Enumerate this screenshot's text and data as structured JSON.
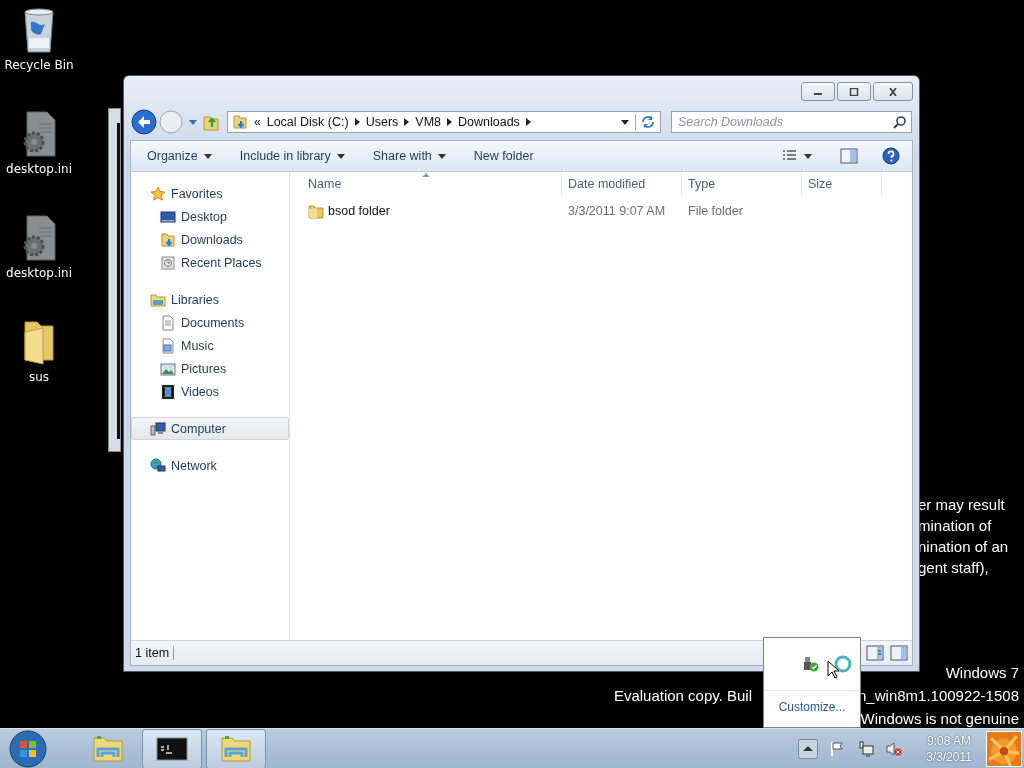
{
  "desktop_icons": [
    {
      "label": "Recycle Bin",
      "kind": "recycle"
    },
    {
      "label": "desktop.ini",
      "kind": "settings-file"
    },
    {
      "label": "desktop.ini",
      "kind": "settings-file"
    },
    {
      "label": "sus",
      "kind": "folder"
    }
  ],
  "background_text": [
    "er may result",
    "mination of",
    "nination of an",
    "gent staff),"
  ],
  "desktop_notice": {
    "edition": "Windows 7",
    "build_parts": [
      "Evaluation copy. Buil",
      "n_win8m1.100922-1508"
    ],
    "genuine": "Windows is not genuine"
  },
  "explorer": {
    "path_overflow": "«",
    "breadcrumb": [
      "Local Disk (C:)",
      "Users",
      "VM8",
      "Downloads"
    ],
    "search": {
      "placeholder": "Search Downloads"
    },
    "toolbar": [
      {
        "label": "Organize",
        "has_menu": true
      },
      {
        "label": "Include in library",
        "has_menu": true
      },
      {
        "label": "Share with",
        "has_menu": true
      },
      {
        "label": "New folder",
        "has_menu": false
      }
    ],
    "sidebar": [
      {
        "label": "Favorites",
        "kind": "star",
        "selected": false,
        "children": [
          {
            "label": "Desktop",
            "kind": "desktop",
            "selected": false
          },
          {
            "label": "Downloads",
            "kind": "downloads",
            "selected": false
          },
          {
            "label": "Recent Places",
            "kind": "recent",
            "selected": false
          }
        ]
      },
      {
        "label": "Libraries",
        "kind": "library",
        "selected": false,
        "children": [
          {
            "label": "Documents",
            "kind": "documents",
            "selected": false
          },
          {
            "label": "Music",
            "kind": "music",
            "selected": false
          },
          {
            "label": "Pictures",
            "kind": "pictures",
            "selected": false
          },
          {
            "label": "Videos",
            "kind": "videos",
            "selected": false
          }
        ]
      },
      {
        "label": "Computer",
        "kind": "computer",
        "selected": true
      },
      {
        "label": "Network",
        "kind": "network",
        "selected": false
      }
    ],
    "columns": [
      {
        "label": "Name",
        "sorted": true
      },
      {
        "label": "Date modified",
        "sorted": false
      },
      {
        "label": "Type",
        "sorted": false
      },
      {
        "label": "Size",
        "sorted": false
      }
    ],
    "rows": [
      {
        "name": "bsod folder",
        "date_modified": "3/3/2011 9:07 AM",
        "type": "File folder"
      }
    ],
    "status": "1 item"
  },
  "tray_popup": {
    "link": "Customize..."
  },
  "taskbar": {
    "tasks": [
      {
        "kind": "explorer",
        "active": false
      },
      {
        "kind": "console",
        "active": true
      },
      {
        "kind": "explorer",
        "active": true
      }
    ],
    "time": "9:08 AM",
    "date": "3/3/2011"
  }
}
